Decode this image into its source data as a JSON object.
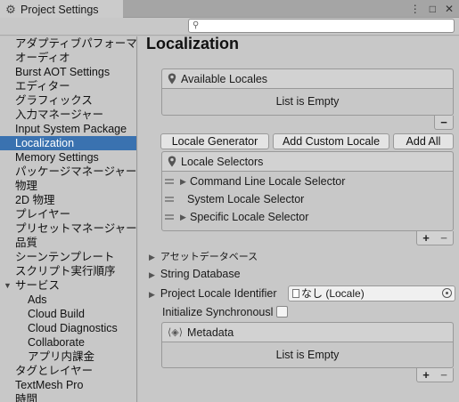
{
  "window": {
    "tab_title": "Project Settings",
    "menu_glyph": "⋮",
    "maximize_glyph": "□",
    "close_glyph": "✕"
  },
  "search": {
    "placeholder": "",
    "icon": "search-icon"
  },
  "sidebar": {
    "items": [
      {
        "label": "アダプティブパフォーマンス",
        "level": 0
      },
      {
        "label": "オーディオ",
        "level": 0
      },
      {
        "label": "Burst AOT Settings",
        "level": 0
      },
      {
        "label": "エディター",
        "level": 0
      },
      {
        "label": "グラフィックス",
        "level": 0
      },
      {
        "label": "入力マネージャー",
        "level": 0
      },
      {
        "label": "Input System Package",
        "level": 0
      },
      {
        "label": "Localization",
        "level": 0,
        "selected": true
      },
      {
        "label": "Memory Settings",
        "level": 0
      },
      {
        "label": "パッケージマネージャー",
        "level": 0
      },
      {
        "label": "物理",
        "level": 0
      },
      {
        "label": "2D 物理",
        "level": 0
      },
      {
        "label": "プレイヤー",
        "level": 0
      },
      {
        "label": "プリセットマネージャー",
        "level": 0
      },
      {
        "label": "品質",
        "level": 0
      },
      {
        "label": "シーンテンプレート",
        "level": 0
      },
      {
        "label": "スクリプト実行順序",
        "level": 0
      },
      {
        "label": "サービス",
        "level": 0,
        "expanded": true
      },
      {
        "label": "Ads",
        "level": 1
      },
      {
        "label": "Cloud Build",
        "level": 1
      },
      {
        "label": "Cloud Diagnostics",
        "level": 1
      },
      {
        "label": "Collaborate",
        "level": 1
      },
      {
        "label": "アプリ内課金",
        "level": 1
      },
      {
        "label": "タグとレイヤー",
        "level": 0
      },
      {
        "label": "TextMesh Pro",
        "level": 0
      },
      {
        "label": "時間",
        "level": 0
      }
    ],
    "expand_glyph": "▼"
  },
  "main": {
    "title": "Localization",
    "available_locales": {
      "header": "Available Locales",
      "empty_text": "List is Empty",
      "remove_label": "−"
    },
    "buttons": {
      "locale_generator": "Locale Generator",
      "add_custom_locale": "Add Custom Locale",
      "add_all": "Add All"
    },
    "locale_selectors": {
      "header": "Locale Selectors",
      "rows": [
        {
          "label": "Command Line Locale Selector",
          "expandable": true
        },
        {
          "label": "System Locale Selector",
          "expandable": false
        },
        {
          "label": "Specific Locale Selector",
          "expandable": true
        }
      ],
      "add_label": "+",
      "remove_label": "−"
    },
    "foldouts": {
      "asset_database": "アセットデータベース",
      "string_database": "String Database",
      "project_locale_identifier": "Project Locale Identifier"
    },
    "project_locale_value": "なし (Locale)",
    "initialize_sync_label": "Initialize Synchronousl",
    "initialize_sync_checked": false,
    "metadata": {
      "header": "Metadata",
      "empty_text": "List is Empty",
      "add_label": "+",
      "remove_label": "−"
    }
  },
  "colors": {
    "selection": "#3a72b0",
    "background": "#c8c8c8"
  }
}
